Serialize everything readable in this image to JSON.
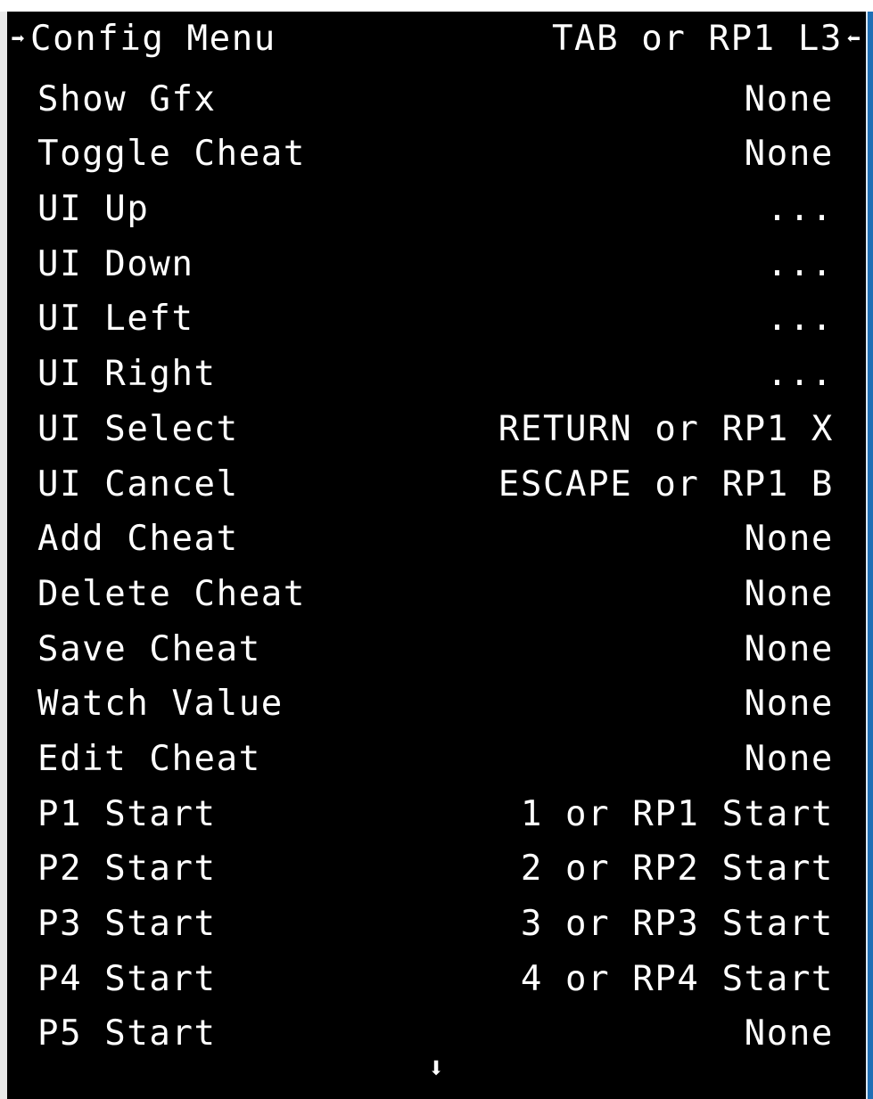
{
  "menu": {
    "title": "Config Menu",
    "title_value": "TAB or RP1 L3",
    "left_marker_icon": "arrow-right-icon",
    "right_marker_icon": "arrow-left-icon",
    "items": [
      {
        "label": "Show Gfx",
        "value": "None"
      },
      {
        "label": "Toggle Cheat",
        "value": "None"
      },
      {
        "label": "UI Up",
        "value": "..."
      },
      {
        "label": "UI Down",
        "value": "..."
      },
      {
        "label": "UI Left",
        "value": "..."
      },
      {
        "label": "UI Right",
        "value": "..."
      },
      {
        "label": "UI Select",
        "value": "RETURN or RP1 X"
      },
      {
        "label": "UI Cancel",
        "value": "ESCAPE or RP1 B"
      },
      {
        "label": "Add Cheat",
        "value": "None"
      },
      {
        "label": "Delete Cheat",
        "value": "None"
      },
      {
        "label": "Save Cheat",
        "value": "None"
      },
      {
        "label": "Watch Value",
        "value": "None"
      },
      {
        "label": "Edit Cheat",
        "value": "None"
      },
      {
        "label": "P1 Start",
        "value": "1 or RP1 Start"
      },
      {
        "label": "P2 Start",
        "value": "2 or RP2 Start"
      },
      {
        "label": "P3 Start",
        "value": "3 or RP3 Start"
      },
      {
        "label": "P4 Start",
        "value": "4 or RP4 Start"
      },
      {
        "label": "P5 Start",
        "value": "None"
      }
    ],
    "scroll_indicator_icon": "arrow-down-icon"
  },
  "glyphs": {
    "arrow_right": "➡",
    "arrow_left": "⬅",
    "arrow_down": "⬇"
  },
  "colors": {
    "background": "#000000",
    "text": "#ffffff",
    "window_edge_blue": "#1f6fb5"
  }
}
